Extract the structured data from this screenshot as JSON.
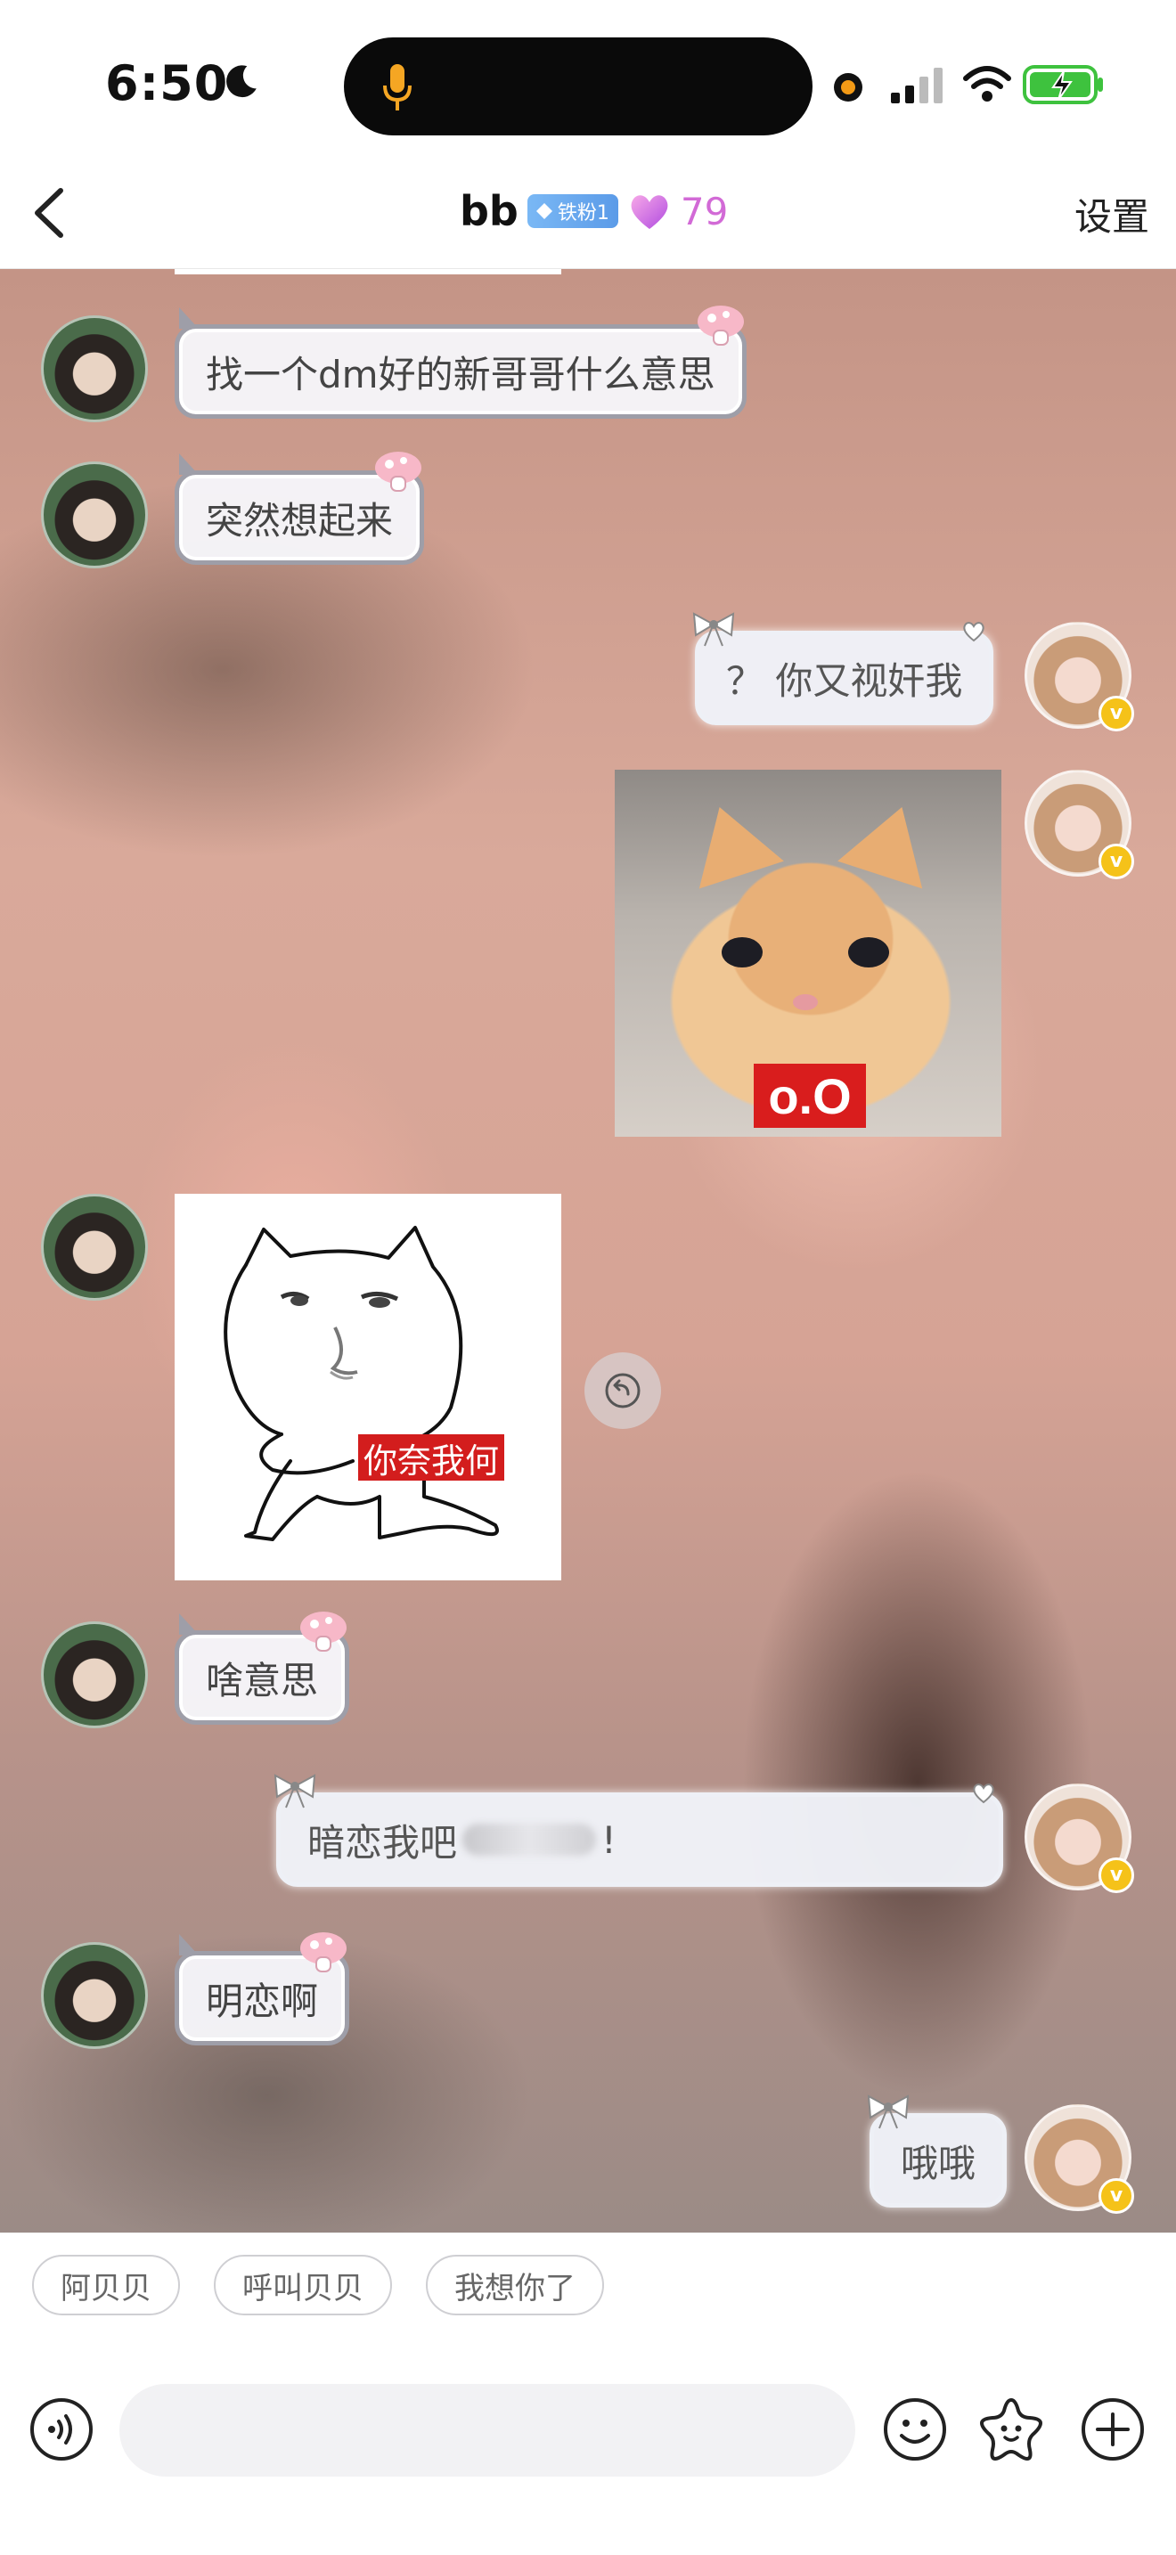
{
  "status_bar": {
    "time": "6:50",
    "icons": [
      "moon-icon",
      "microphone-icon",
      "recording-dot-icon",
      "cellular-signal-icon",
      "wifi-icon",
      "battery-charging-icon"
    ]
  },
  "header": {
    "name": "bb",
    "fan_badge": "铁粉1",
    "heart_count": "79",
    "settings_label": "设置",
    "back_icon": "chevron-left-icon"
  },
  "messages": [
    {
      "side": "left",
      "type": "text",
      "text": "找一个dm好的新哥哥什么意思"
    },
    {
      "side": "left",
      "type": "text",
      "text": "突然想起来"
    },
    {
      "side": "right",
      "type": "text",
      "text": "？ 你又视奸我"
    },
    {
      "side": "right",
      "type": "sticker",
      "sticker_text": "o.O"
    },
    {
      "side": "left",
      "type": "sticker",
      "sticker_text": "你奈我何"
    },
    {
      "side": "left",
      "type": "text",
      "text": "啥意思"
    },
    {
      "side": "right",
      "type": "text",
      "text_before": "暗恋我吧",
      "text_after": "!"
    },
    {
      "side": "left",
      "type": "text",
      "text": "明恋啊"
    },
    {
      "side": "right",
      "type": "text",
      "text": "哦哦"
    }
  ],
  "quick_replies": [
    "阿贝贝",
    "呼叫贝贝",
    "我想你了"
  ],
  "input": {
    "placeholder": "",
    "value": ""
  },
  "colors": {
    "heart_count": "#d26ad6",
    "fan_badge": "#5b9be8",
    "vip_badge": "#f5c219",
    "sticker_label": "#d91d1d"
  }
}
